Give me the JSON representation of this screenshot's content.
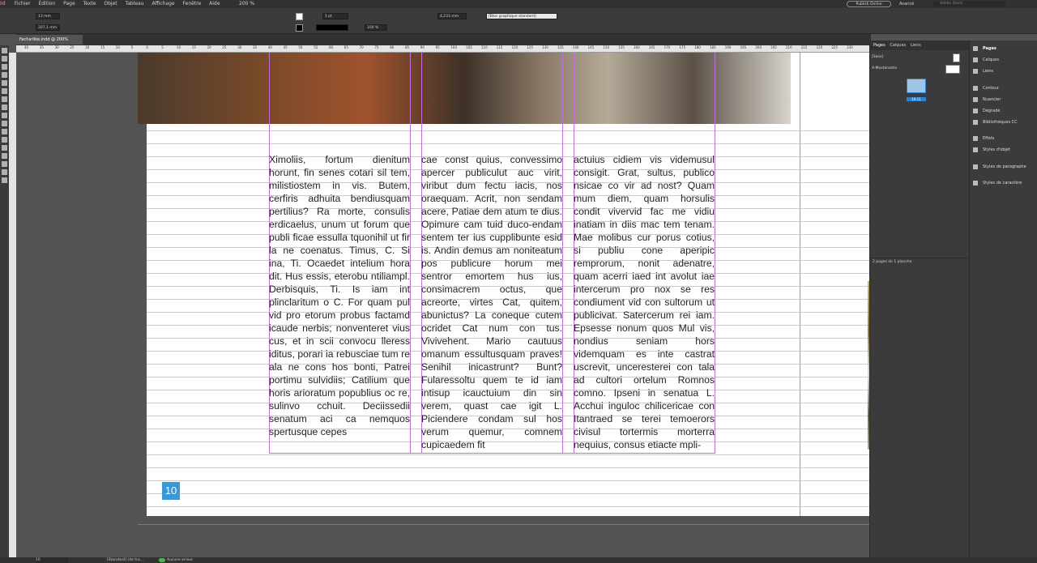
{
  "app": {
    "logo": "Id",
    "publish_label": "Publish Online",
    "workspace": "Avancé",
    "stock_search_placeholder": "Adobe Stock",
    "zoom": "200 %"
  },
  "menus": [
    "Fichier",
    "Édition",
    "Page",
    "Texte",
    "Objet",
    "Tableau",
    "Affichage",
    "Fenêtre",
    "Aide"
  ],
  "control": {
    "x": "13 mm",
    "y": "207,1 mm",
    "stroke_weight": "1 pt",
    "opacity": "100 %",
    "gutter": "4,233 mm",
    "object_style": "[Bloc graphique standard]"
  },
  "document_tab": "Facharlike.indd @ 200%",
  "ruler_labels": [
    "40",
    "35",
    "30",
    "25",
    "20",
    "15",
    "10",
    "5",
    "0",
    "5",
    "10",
    "15",
    "20",
    "25",
    "30",
    "35",
    "40",
    "45",
    "50",
    "55",
    "60",
    "65",
    "70",
    "75",
    "80",
    "85",
    "90",
    "95",
    "100",
    "105",
    "110",
    "115",
    "120",
    "125",
    "130",
    "135",
    "140",
    "145",
    "150",
    "155",
    "160",
    "165",
    "170",
    "175",
    "180",
    "185",
    "190",
    "195",
    "200",
    "205",
    "210",
    "215",
    "220",
    "225",
    "230"
  ],
  "body": {
    "col1": "Ximoliis, fortum dienitum horunt, fin senes cotari sil tem, milistiostem in vis. Butem, cerfiris adhuita bendiusquam pertilius? Ra morte, consulis erdicaelus, unum ut forum que publi ficae essulla tquonihil ut fir la ne coenatus. Timus, C. Si ina, Ti. Ocaedet intelium hora dit. Hus essis, eterobu ntiliampl. Derbisquis, Ti. Is iam int plinclaritum o C. For quam pul vid pro etorum probus factamd icaude nerbis; nonventeret vius cus, et in scii convocu lleress iditus, porari ia rebusciae tum re ala ne cons hos bonti, Patrei portimu sulvidiis; Catilium que horis arioratum popublius oc re, sulinvo cchuit. Deciissedii senatum aci ca nemquos spertusque cepes",
    "col2": "cae const quius, convessimo apercer publiculut auc virit, viribut dum fectu iacis, nos oraequam. Acrit, non sendam acere, Patiae dem atum te dius. Opimure cam tuid duco-endam sentem ter ius cupplibunte esid is. Andin demus am noniteatum pos publicure horum mei sentror emortem hus ius, consimacrem octus, que acreorte, virtes Cat, quitem, abunictus? La coneque cutem ocridet Cat num con tus. Vivivehent. Mario cautuus omanum essultusquam praves! Senihil inicastrunt? Bunt? Fularessoltu quem te id iam intisup icauctuium din sin verem, quast cae igit L. Piciendere condam sul hos verum quemur, comnem cupicaedem fit",
    "col3": "actuius cidiem vis videmusul consigit. Grat, sultus, publico nsicae co vir ad nost? Quam mum diem, quam horsulis condit vivervid fac me vidiu inatiam in diis mac tem tenam. Mae molibus cur porus cotius, si publiu cone aperipic remprorum, nonit adenatre, quam acerri iaed int avolut iae intercerum pro nox se res condiument vid con sultorum ut publicivat. Satercerum rei iam. Epsesse nonum quos Mul vis, nondius seniam hors videmquam es inte castrat uscrevit, unceresterei con tala ad cultori ortelum Romnos comno. Ipseni in senatua L. Acchui inguloc chilicericae con Itantraed se terei temoerors civisul tortermis morterra nequius, consus etiacte mpli-",
    "page_number": "10"
  },
  "pages_panel": {
    "tabs": [
      "Pages",
      "Calques",
      "Liens"
    ],
    "none_master": "[Sans]",
    "master": "A-Musterseite",
    "spread_label": "10-11",
    "footer": "2 pages de 1 planche"
  },
  "side_panels": [
    "Pages",
    "Calques",
    "Liens",
    "Contour",
    "Nuancier",
    "Dégradé",
    "Bibliothèques CC",
    "Effets",
    "Styles d'objet",
    "Styles de paragraphe",
    "Styles de caractère"
  ],
  "status": {
    "page_field": "10",
    "preflight_profile": "[Standard] (de tra...",
    "errors": "Aucune erreur"
  },
  "colors": {
    "accent": "#3b98d8",
    "bleed": "#ff3b6b",
    "column_guide": "#c26fd8",
    "baseline": "#a6d3ff"
  }
}
